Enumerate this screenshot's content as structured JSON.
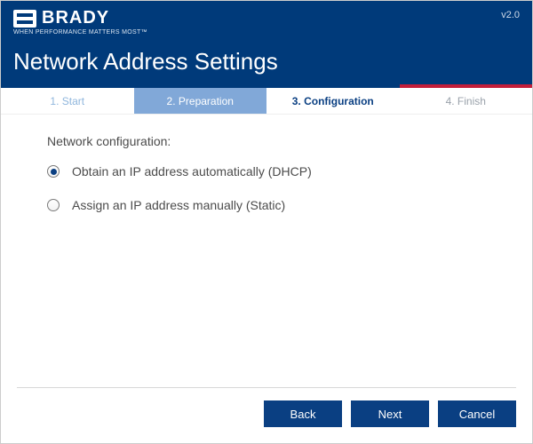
{
  "brand": {
    "name": "BRADY",
    "tagline": "WHEN PERFORMANCE MATTERS MOST™"
  },
  "version": "v2.0",
  "page_title": "Network Address Settings",
  "steps": [
    {
      "label": "1. Start"
    },
    {
      "label": "2. Preparation"
    },
    {
      "label": "3. Configuration"
    },
    {
      "label": "4. Finish"
    }
  ],
  "form": {
    "heading": "Network configuration:",
    "options": {
      "dhcp": "Obtain an IP address automatically (DHCP)",
      "static": "Assign an IP address manually (Static)"
    },
    "selected": "dhcp"
  },
  "buttons": {
    "back": "Back",
    "next": "Next",
    "cancel": "Cancel"
  }
}
